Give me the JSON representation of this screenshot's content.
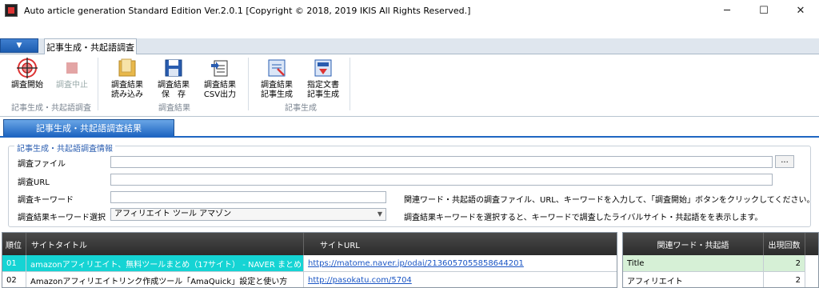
{
  "window": {
    "title": "Auto article generation Standard Edition Ver.2.0.1  [Copyright © 2018, 2019 IKIS All Rights Reserved.]",
    "minimize": "─",
    "maximize": "☐",
    "close": "✕"
  },
  "ribbon": {
    "app_menu": "▼",
    "tab": "記事生成・共起語調査",
    "buttons": {
      "start": {
        "l1": "調査開始",
        "l2": "",
        "icon": "target-icon"
      },
      "stop": {
        "l1": "調査中止",
        "l2": "",
        "icon": "stop-icon"
      },
      "load": {
        "l1": "調査結果",
        "l2": "読み込み",
        "icon": "folder-icon"
      },
      "save": {
        "l1": "調査結果",
        "l2": "保　存",
        "icon": "floppy-icon"
      },
      "csv": {
        "l1": "調査結果",
        "l2": "CSV出力",
        "icon": "csv-export-icon"
      },
      "gen_result": {
        "l1": "調査結果",
        "l2": "記事生成",
        "icon": "article-generate-icon"
      },
      "gen_doc": {
        "l1": "指定文書",
        "l2": "記事生成",
        "icon": "document-generate-icon"
      }
    },
    "groups": [
      "記事生成・共起語調査",
      "調査結果",
      "記事生成"
    ]
  },
  "section_tab": "記事生成・共起語調査結果",
  "form": {
    "group_title": "記事生成・共起語調査情報",
    "file_label": "調査ファイル",
    "file_value": "",
    "browse": "...",
    "url_label": "調査URL",
    "url_value": "",
    "keyword_label": "調査キーワード",
    "keyword_value": "",
    "select_label": "調査結果キーワード選択",
    "select_value": "アフィリエイト ツール アマゾン",
    "hint1": "関連ワード・共起語の調査ファイル、URL、キーワードを入力して、「調査開始」ボタンをクリックしてください。",
    "hint2": "調査結果キーワードを選択すると、キーワードで調査したライバルサイト・共起語をを表示します。"
  },
  "results": {
    "headers": [
      "順位",
      "サイトタイトル",
      "サイトURL"
    ],
    "rows": [
      {
        "rank": "01",
        "title": "amazonアフィリエイト、無料ツールまとめ（17サイト） - NAVER まとめ",
        "url": "https://matome.naver.jp/odai/2136057055858644201"
      },
      {
        "rank": "02",
        "title": "Amazonアフィリエイトリンク作成ツール「AmaQuick」設定と使い方",
        "url": "http://pasokatu.com/5704"
      }
    ]
  },
  "words": {
    "headers": [
      "関連ワード・共起語",
      "出現回数"
    ],
    "rows": [
      {
        "word": "Title",
        "count": "2"
      },
      {
        "word": "アフィリエイト",
        "count": "2"
      }
    ]
  }
}
